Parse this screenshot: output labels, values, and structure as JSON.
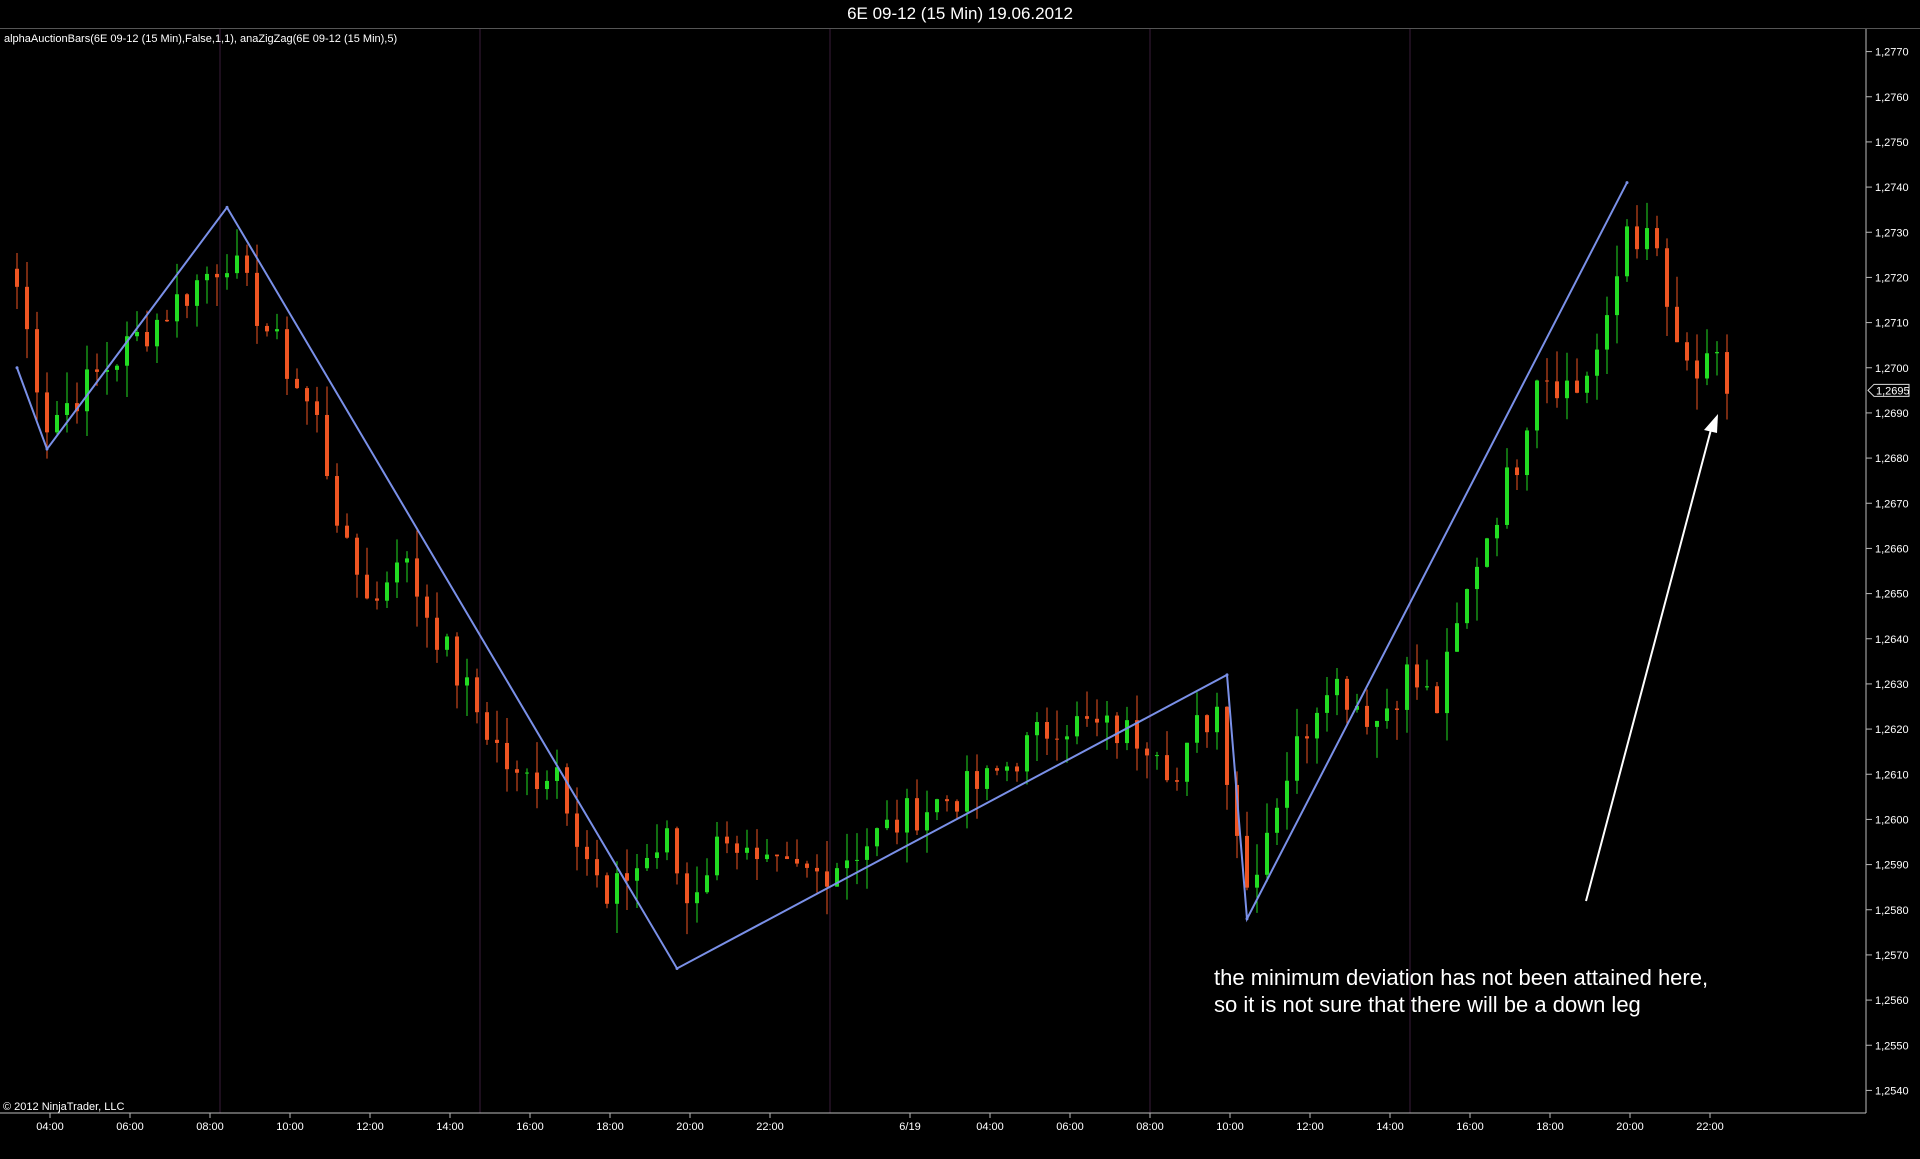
{
  "window": {
    "title": "6E 09-12 (15 Min)  19.06.2012"
  },
  "indicator_label": "alphaAuctionBars(6E 09-12 (15 Min),False,1,1), anaZigZag(6E 09-12 (15 Min),5)",
  "copyright": "© 2012 NinjaTrader, LLC",
  "annotation": {
    "line1": "the minimum deviation has not been attained here,",
    "line2": "so it is not sure that there will be a down leg"
  },
  "colors": {
    "background": "#000000",
    "up_bar": "#22dd22",
    "down_bar": "#ee5522",
    "zigzag": "#7a90e8",
    "session_line": "#3a1c3a",
    "axis": "#bbbbbb"
  },
  "chart_data": {
    "type": "candlestick",
    "instrument": "6E 09-12",
    "interval": "15 Min",
    "ylim": [
      1.2535,
      1.2775
    ],
    "y_ticks": [
      "1,2540",
      "1,2550",
      "1,2560",
      "1,2570",
      "1,2580",
      "1,2590",
      "1,2600",
      "1,2610",
      "1,2620",
      "1,2630",
      "1,2640",
      "1,2650",
      "1,2660",
      "1,2670",
      "1,2680",
      "1,2690",
      "1,2700",
      "1,2710",
      "1,2720",
      "1,2730",
      "1,2740",
      "1,2750",
      "1,2760",
      "1,2770"
    ],
    "y_tick_values": [
      1.254,
      1.255,
      1.256,
      1.257,
      1.258,
      1.259,
      1.26,
      1.261,
      1.262,
      1.263,
      1.264,
      1.265,
      1.266,
      1.267,
      1.268,
      1.269,
      1.27,
      1.271,
      1.272,
      1.273,
      1.274,
      1.275,
      1.276,
      1.277
    ],
    "x_ticks": [
      "04:00",
      "06:00",
      "08:00",
      "10:00",
      "12:00",
      "14:00",
      "16:00",
      "18:00",
      "20:00",
      "22:00",
      "6/19",
      "04:00",
      "06:00",
      "08:00",
      "10:00",
      "12:00",
      "14:00",
      "16:00",
      "18:00",
      "20:00",
      "22:00"
    ],
    "x_tick_index": [
      3,
      11,
      19,
      27,
      35,
      43,
      51,
      59,
      67,
      75,
      89,
      97,
      105,
      113,
      121,
      129,
      137,
      145,
      153,
      161,
      169
    ],
    "bar_count": 172,
    "session_breaks": [
      20,
      46,
      81,
      113,
      139
    ],
    "last_price": "1,2695",
    "zigzag": [
      {
        "index": 0,
        "price": 1.27
      },
      {
        "index": 3,
        "price": 1.2682
      },
      {
        "index": 21,
        "price": 1.27355
      },
      {
        "index": 66,
        "price": 1.2567
      },
      {
        "index": 121,
        "price": 1.2632
      },
      {
        "index": 123,
        "price": 1.2578
      },
      {
        "index": 161,
        "price": 1.2741
      }
    ],
    "swing_closes": [
      {
        "index": 0,
        "price": 1.2718
      },
      {
        "index": 3,
        "price": 1.2688
      },
      {
        "index": 21,
        "price": 1.2725
      },
      {
        "index": 30,
        "price": 1.2688
      },
      {
        "index": 33,
        "price": 1.2658
      },
      {
        "index": 36,
        "price": 1.2648
      },
      {
        "index": 38,
        "price": 1.266
      },
      {
        "index": 44,
        "price": 1.2632
      },
      {
        "index": 50,
        "price": 1.2608
      },
      {
        "index": 54,
        "price": 1.2612
      },
      {
        "index": 56,
        "price": 1.2598
      },
      {
        "index": 59,
        "price": 1.258
      },
      {
        "index": 61,
        "price": 1.2588
      },
      {
        "index": 65,
        "price": 1.2595
      },
      {
        "index": 67,
        "price": 1.2582
      },
      {
        "index": 71,
        "price": 1.2598
      },
      {
        "index": 74,
        "price": 1.2588
      },
      {
        "index": 80,
        "price": 1.2588
      },
      {
        "index": 90,
        "price": 1.2602
      },
      {
        "index": 97,
        "price": 1.2608
      },
      {
        "index": 104,
        "price": 1.2622
      },
      {
        "index": 108,
        "price": 1.262
      },
      {
        "index": 114,
        "price": 1.2618
      },
      {
        "index": 116,
        "price": 1.2608
      },
      {
        "index": 118,
        "price": 1.262
      },
      {
        "index": 120,
        "price": 1.2625
      },
      {
        "index": 123,
        "price": 1.2585
      },
      {
        "index": 126,
        "price": 1.2605
      },
      {
        "index": 131,
        "price": 1.2632
      },
      {
        "index": 136,
        "price": 1.2622
      },
      {
        "index": 139,
        "price": 1.2632
      },
      {
        "index": 142,
        "price": 1.2625
      },
      {
        "index": 146,
        "price": 1.2658
      },
      {
        "index": 150,
        "price": 1.268
      },
      {
        "index": 152,
        "price": 1.27
      },
      {
        "index": 156,
        "price": 1.2695
      },
      {
        "index": 159,
        "price": 1.2708
      },
      {
        "index": 161,
        "price": 1.2732
      },
      {
        "index": 164,
        "price": 1.2725
      },
      {
        "index": 166,
        "price": 1.2702
      },
      {
        "index": 168,
        "price": 1.2698
      },
      {
        "index": 170,
        "price": 1.27
      },
      {
        "index": 171,
        "price": 1.2695
      }
    ]
  }
}
